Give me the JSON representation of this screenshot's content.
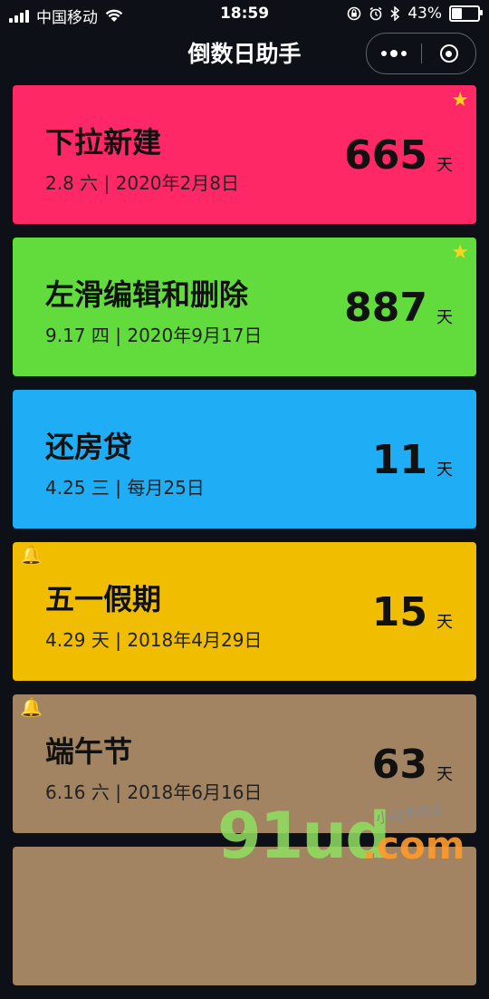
{
  "status_bar": {
    "carrier": "中国移动",
    "time": "18:59",
    "battery": "43%",
    "battery_level": 0.43
  },
  "nav": {
    "title": "倒数日助手"
  },
  "cards": [
    {
      "name": "下拉新建",
      "subtitle": "2.8 六 | 2020年2月8日",
      "days": "665",
      "unit": "天",
      "color": "#ff2866",
      "badge": "star"
    },
    {
      "name": "左滑编辑和删除",
      "subtitle": "9.17 四 | 2020年9月17日",
      "days": "887",
      "unit": "天",
      "color": "#62dc3d",
      "badge": "star"
    },
    {
      "name": "还房贷",
      "subtitle": "4.25 三 | 每月25日",
      "days": "11",
      "unit": "天",
      "color": "#1fadf5",
      "badge": ""
    },
    {
      "name": "五一假期",
      "subtitle": "4.29 天 | 2018年4月29日",
      "days": "15",
      "unit": "天",
      "color": "#f0bd00",
      "badge": "bell"
    },
    {
      "name": "端午节",
      "subtitle": "6.16 六 | 2018年6月16日",
      "days": "63",
      "unit": "天",
      "color": "#a38462",
      "badge": "bell"
    },
    {
      "name": "",
      "subtitle": "",
      "days": "",
      "unit": "",
      "color": "#a38462",
      "badge": ""
    }
  ],
  "watermark": {
    "brand": "91ud",
    "tld": ".com",
    "tagline": "小程序商店"
  }
}
